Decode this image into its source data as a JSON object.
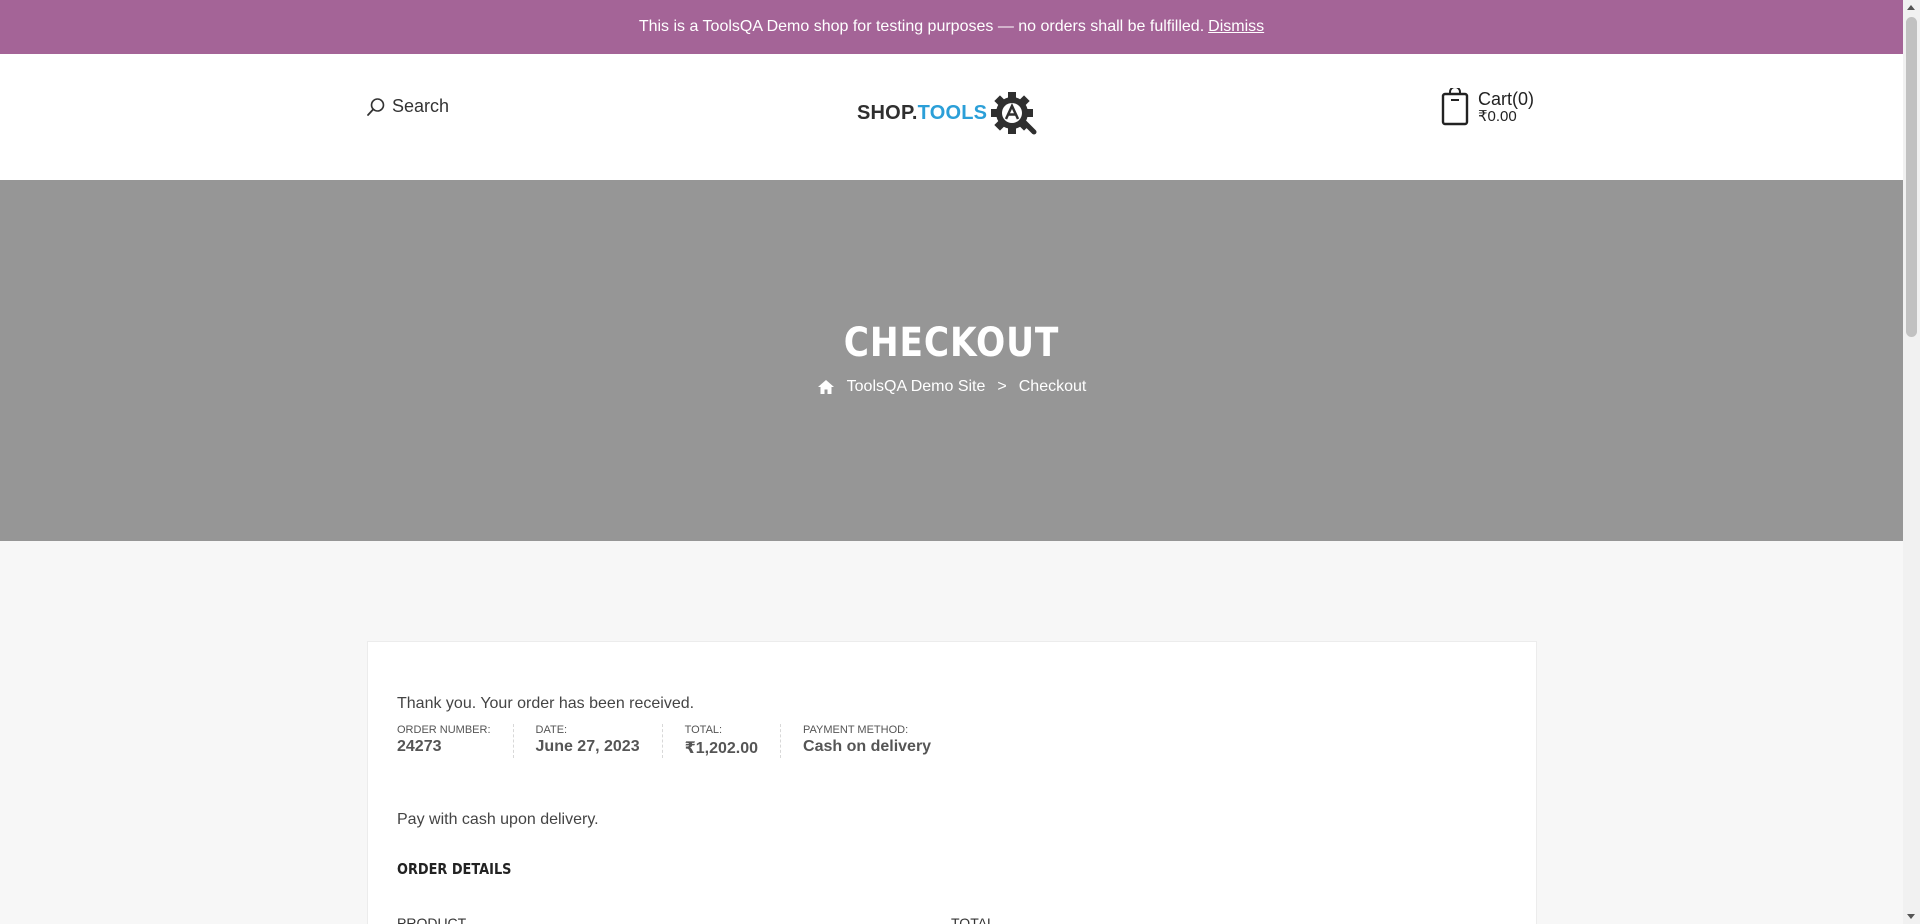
{
  "notice": {
    "text": "This is a ToolsQA Demo shop for testing purposes — no orders shall be fulfilled.",
    "dismiss": "Dismiss"
  },
  "header": {
    "search_label": "Search",
    "logo_part1": "SHOP.",
    "logo_part2": "TOOLS",
    "cart_label": "Cart(0)",
    "cart_amount": "₹0.00"
  },
  "hero": {
    "title": "CHECKOUT",
    "breadcrumb": [
      "ToolsQA Demo Site",
      ">",
      "Checkout"
    ]
  },
  "order": {
    "thanks": "Thank you. Your order has been received.",
    "overview": [
      {
        "label": "ORDER NUMBER:",
        "value": "24273"
      },
      {
        "label": "DATE:",
        "value": "June 27, 2023"
      },
      {
        "label": "TOTAL:",
        "value": "₹1,202.00"
      },
      {
        "label": "PAYMENT METHOD:",
        "value": "Cash on delivery"
      }
    ],
    "payment_note": "Pay with cash upon delivery.",
    "details_title": "ORDER DETAILS",
    "columns": [
      "PRODUCT",
      "TOTAL"
    ]
  },
  "colors": {
    "notice_bg": "#a46497",
    "hero_bg": "#969696",
    "logo_accent": "#2b9fd8"
  }
}
